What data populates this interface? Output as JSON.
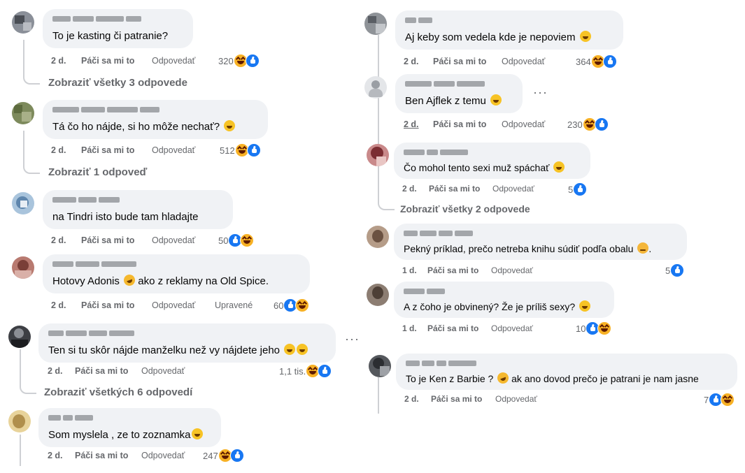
{
  "labels": {
    "like": "Páči sa mi to",
    "reply": "Odpovedať",
    "edited": "Upravené"
  },
  "colors": {
    "bubble": "#f0f2f5",
    "meta": "#65676b",
    "like": "#1877f2",
    "haha": "#f7b125"
  },
  "left": {
    "c1": {
      "text": "To je kasting či patranie?",
      "time": "2 d.",
      "count": "320",
      "show": "Zobraziť všetky 3 odpovede"
    },
    "c2": {
      "text": "Tá čo ho nájde, si ho môže nechať?",
      "time": "2 d.",
      "count": "512",
      "show": "Zobraziť 1 odpoveď"
    },
    "c3": {
      "text": "na Tindri isto bude tam hladajte",
      "time": "2 d.",
      "count": "50"
    },
    "c4": {
      "text_a": "Hotovy Adonis",
      "text_b": "ako z reklamy na Old Spice.",
      "time": "2 d.",
      "count": "60"
    },
    "c5": {
      "text": "Ten si tu skôr nájde manželku než vy nájdete jeho",
      "time": "2 d.",
      "count": "1,1 tis.",
      "show": "Zobraziť všetkých 6 odpovedí"
    },
    "c6": {
      "text": "Som myslela , ze to zoznamka",
      "time": "2 d.",
      "count": "247"
    }
  },
  "right": {
    "c1": {
      "text": "Aj keby som vedela kde je nepoviem",
      "time": "2 d.",
      "count": "364"
    },
    "c2": {
      "text": "Ben Ajflek z temu",
      "time": "2 d.",
      "count": "230"
    },
    "c3": {
      "text": "Čo mohol tento sexi muž spáchať",
      "time": "2 d.",
      "count": "5",
      "show": "Zobraziť všetky 2 odpovede"
    },
    "c4": {
      "text": "Pekný príklad, prečo netreba knihu súdiť podľa obalu",
      "time": "1 d.",
      "count": "5"
    },
    "c5": {
      "text": "A z čoho je obvinený? Že je príliš sexy?",
      "time": "1 d.",
      "count": "10"
    },
    "c6": {
      "text_a": "To je Ken z Barbie ?",
      "text_b": "ak ano dovod prečo je patrani je nam jasne",
      "time": "2 d.",
      "count": "7"
    }
  },
  "icons": [
    "haha-reaction-icon",
    "like-reaction-icon",
    "more-options-icon",
    "emoji-icon"
  ]
}
